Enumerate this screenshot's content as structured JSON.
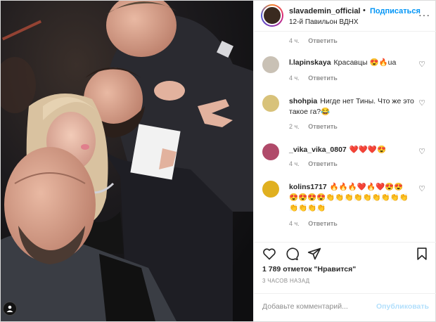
{
  "header": {
    "username": "slavademin_official",
    "separator": "•",
    "follow_label": "Подписаться",
    "location": "12-й Павильон ВДНХ",
    "more_glyph": "···"
  },
  "comments": [
    {
      "meta_time": "4 ч.",
      "reply_label": "Ответить"
    },
    {
      "username": "l.lapinskaya",
      "text": "Красавцы 😍🔥ua",
      "time": "4 ч.",
      "reply_label": "Ответить",
      "avatar_color": "#c9c1b5"
    },
    {
      "username": "shohpia",
      "text": "Нигде нет Тины. Что же это такое га?😂",
      "time": "2 ч.",
      "reply_label": "Ответить",
      "avatar_color": "#d8c27a"
    },
    {
      "username": "_vika_vika_0807",
      "text": "❤️❤️❤️😍",
      "time": "4 ч.",
      "reply_label": "Ответить",
      "avatar_color": "#b04a6a"
    },
    {
      "username": "kolins1717",
      "text": "🔥🔥🔥❤️🔥❤️😍😍😍😍😍😍👏👏👏👏👏👏👏👏👏👏👏👏👏",
      "time": "4 ч.",
      "reply_label": "Ответить",
      "avatar_color": "#e0b020"
    }
  ],
  "actions": {
    "like_icon": "heart-icon",
    "comment_icon": "comment-icon",
    "share_icon": "share-icon",
    "save_icon": "bookmark-icon"
  },
  "likes_text": "1 789 отметок \"Нравится\"",
  "posted_time": "3 ЧАСОВ НАЗАД",
  "add_comment": {
    "placeholder": "Добавьте комментарий...",
    "publish_label": "Опубликовать"
  },
  "colors": {
    "accent": "#0095f6",
    "publish_disabled": "#b2dffc",
    "muted": "#8e8e8e",
    "text": "#262626"
  }
}
